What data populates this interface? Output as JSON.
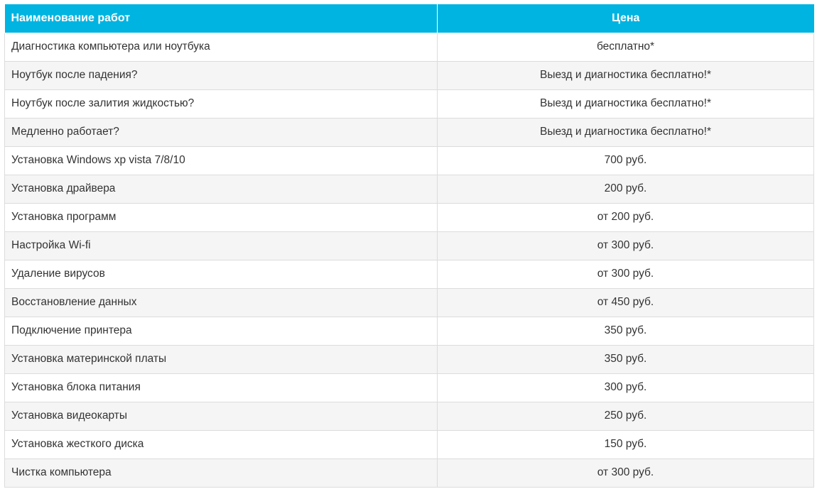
{
  "price_table": {
    "header": {
      "name_label": "Наименование работ",
      "price_label": "Цена"
    },
    "header_color": "#00b4e1",
    "rows": [
      {
        "name": "Диагностика компьютера или ноутбука",
        "price": "бесплатно*"
      },
      {
        "name": "Ноутбук после падения?",
        "price": "Выезд и диагностика бесплатно!*"
      },
      {
        "name": "Ноутбук после залития жидкостью?",
        "price": "Выезд и диагностика бесплатно!*"
      },
      {
        "name": "Медленно работает?",
        "price": "Выезд и диагностика бесплатно!*"
      },
      {
        "name": "Установка Windows xp vista 7/8/10",
        "price": "700 руб."
      },
      {
        "name": "Установка драйвера",
        "price": "200 руб."
      },
      {
        "name": "Установка программ",
        "price": "от 200 руб."
      },
      {
        "name": "Настройка Wi-fi",
        "price": "от 300 руб."
      },
      {
        "name": "Удаление вирусов",
        "price": "от 300 руб."
      },
      {
        "name": "Восстановление данных",
        "price": "от 450 руб."
      },
      {
        "name": "Подключение принтера",
        "price": "350 руб."
      },
      {
        "name": "Установка материнской платы",
        "price": "350 руб."
      },
      {
        "name": "Установка блока питания",
        "price": "300 руб."
      },
      {
        "name": "Установка видеокарты",
        "price": "250 руб."
      },
      {
        "name": "Установка жесткого диска",
        "price": "150 руб."
      },
      {
        "name": "Чистка компьютера",
        "price": "от 300 руб."
      }
    ]
  }
}
